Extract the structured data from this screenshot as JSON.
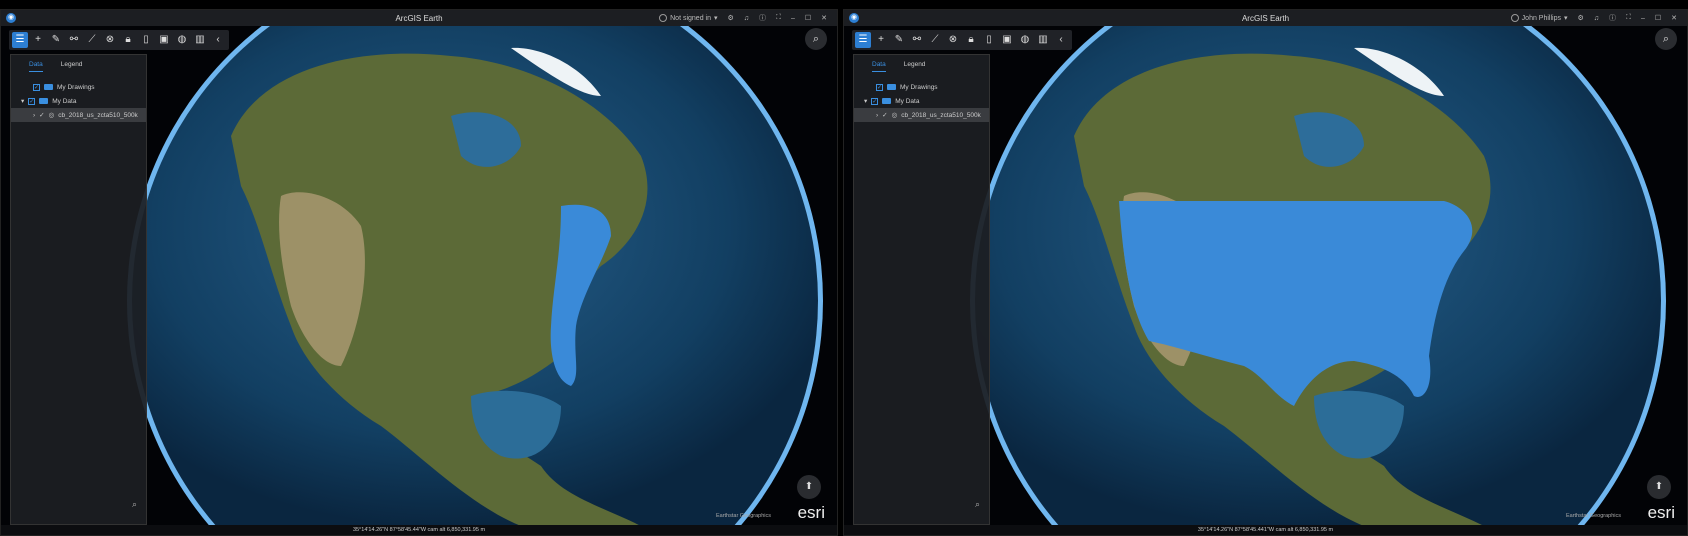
{
  "windows": [
    {
      "title": "ArcGIS Earth",
      "user": "Not signed in",
      "status": "35°14'14.26\"N 87°58'45.44\"W  cam alt 6,850,331.95 m",
      "attribution": "Earthstar Geographics",
      "logo": "esri",
      "overlay": "east"
    },
    {
      "title": "ArcGIS Earth",
      "user": "John Phillips",
      "status": "35°14'14.26\"N 87°58'45.441\"W  cam alt 6,850,331.95 m",
      "attribution": "Earthstar Geographics",
      "logo": "esri",
      "overlay": "full"
    }
  ],
  "panel": {
    "tabs": [
      "Data",
      "Legend"
    ],
    "items": [
      "My Drawings",
      "My Data",
      "cb_2018_us_zcta510_500k"
    ]
  },
  "colors": {
    "accent": "#2d7fd3",
    "overlay": "#3a8ad8"
  }
}
